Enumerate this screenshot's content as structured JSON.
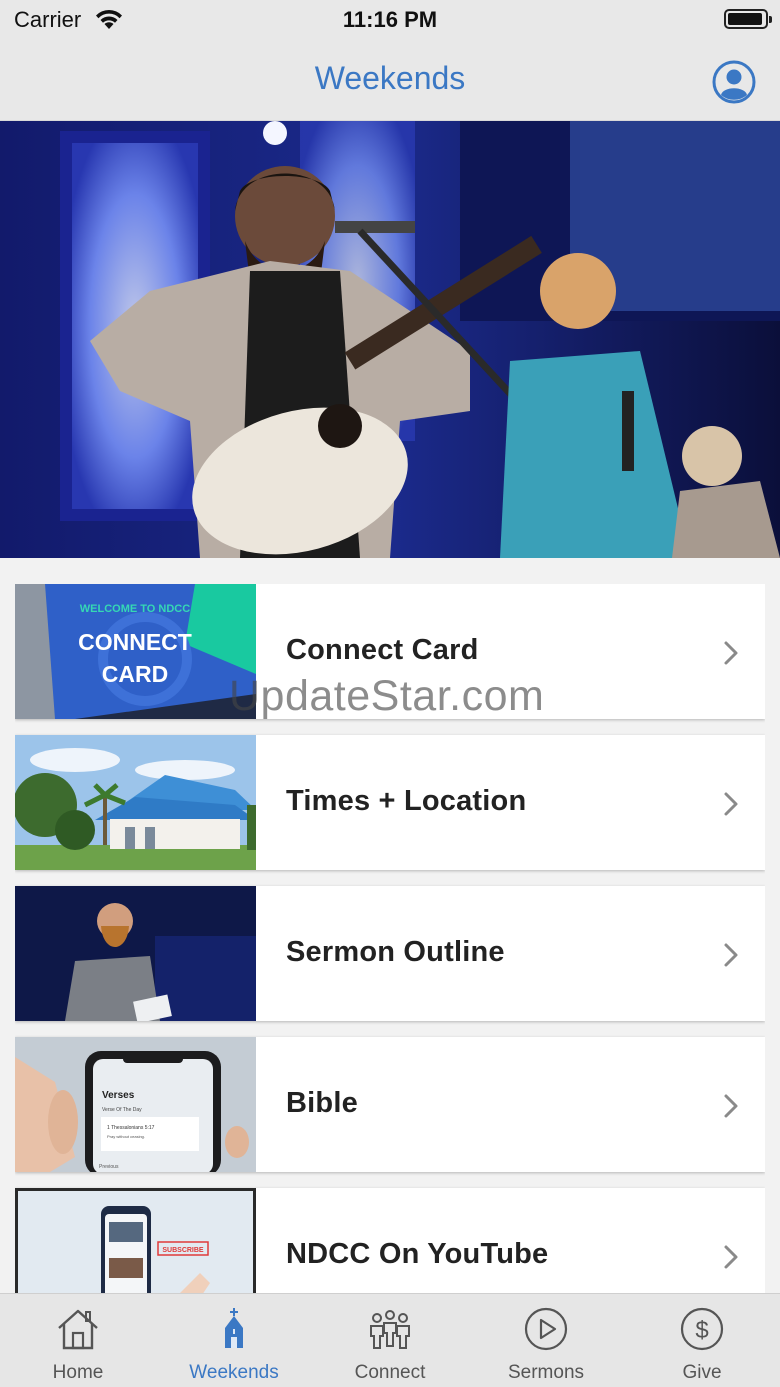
{
  "status_bar": {
    "carrier": "Carrier",
    "time": "11:16 PM",
    "battery_level": 0.95
  },
  "nav": {
    "title": "Weekends",
    "profile_icon": "person-circle-icon"
  },
  "hero": {
    "description_icon": "worship-band-photo"
  },
  "items": [
    {
      "label": "Connect Card",
      "thumb_icon": "connect-card-graphic",
      "thumb_lines": [
        "WELCOME TO NDCC",
        "CONNECT",
        "CARD"
      ]
    },
    {
      "label": "Times + Location",
      "thumb_icon": "church-building-photo"
    },
    {
      "label": "Sermon Outline",
      "thumb_icon": "pastor-speaking-photo"
    },
    {
      "label": "Bible",
      "thumb_icon": "phone-bible-app-photo",
      "thumb_lines": [
        "Verses",
        "Verse Of The Day",
        "1 Thessalonians 5:17",
        "Pray without ceasing.",
        "Previous"
      ]
    },
    {
      "label": "NDCC On YouTube",
      "thumb_icon": "youtube-phone-photo",
      "thumb_lines": [
        "SUBSCRIBE"
      ]
    }
  ],
  "watermark": "UpdateStar.com",
  "tabs": [
    {
      "label": "Home",
      "icon": "house-icon",
      "active": false
    },
    {
      "label": "Weekends",
      "icon": "church-icon",
      "active": true
    },
    {
      "label": "Connect",
      "icon": "people-icon",
      "active": false
    },
    {
      "label": "Sermons",
      "icon": "play-circle-icon",
      "active": false
    },
    {
      "label": "Give",
      "icon": "dollar-circle-icon",
      "active": false
    }
  ],
  "colors": {
    "accent": "#3b78c4",
    "tab_inactive": "#555555",
    "background": "#f2f2f2"
  }
}
